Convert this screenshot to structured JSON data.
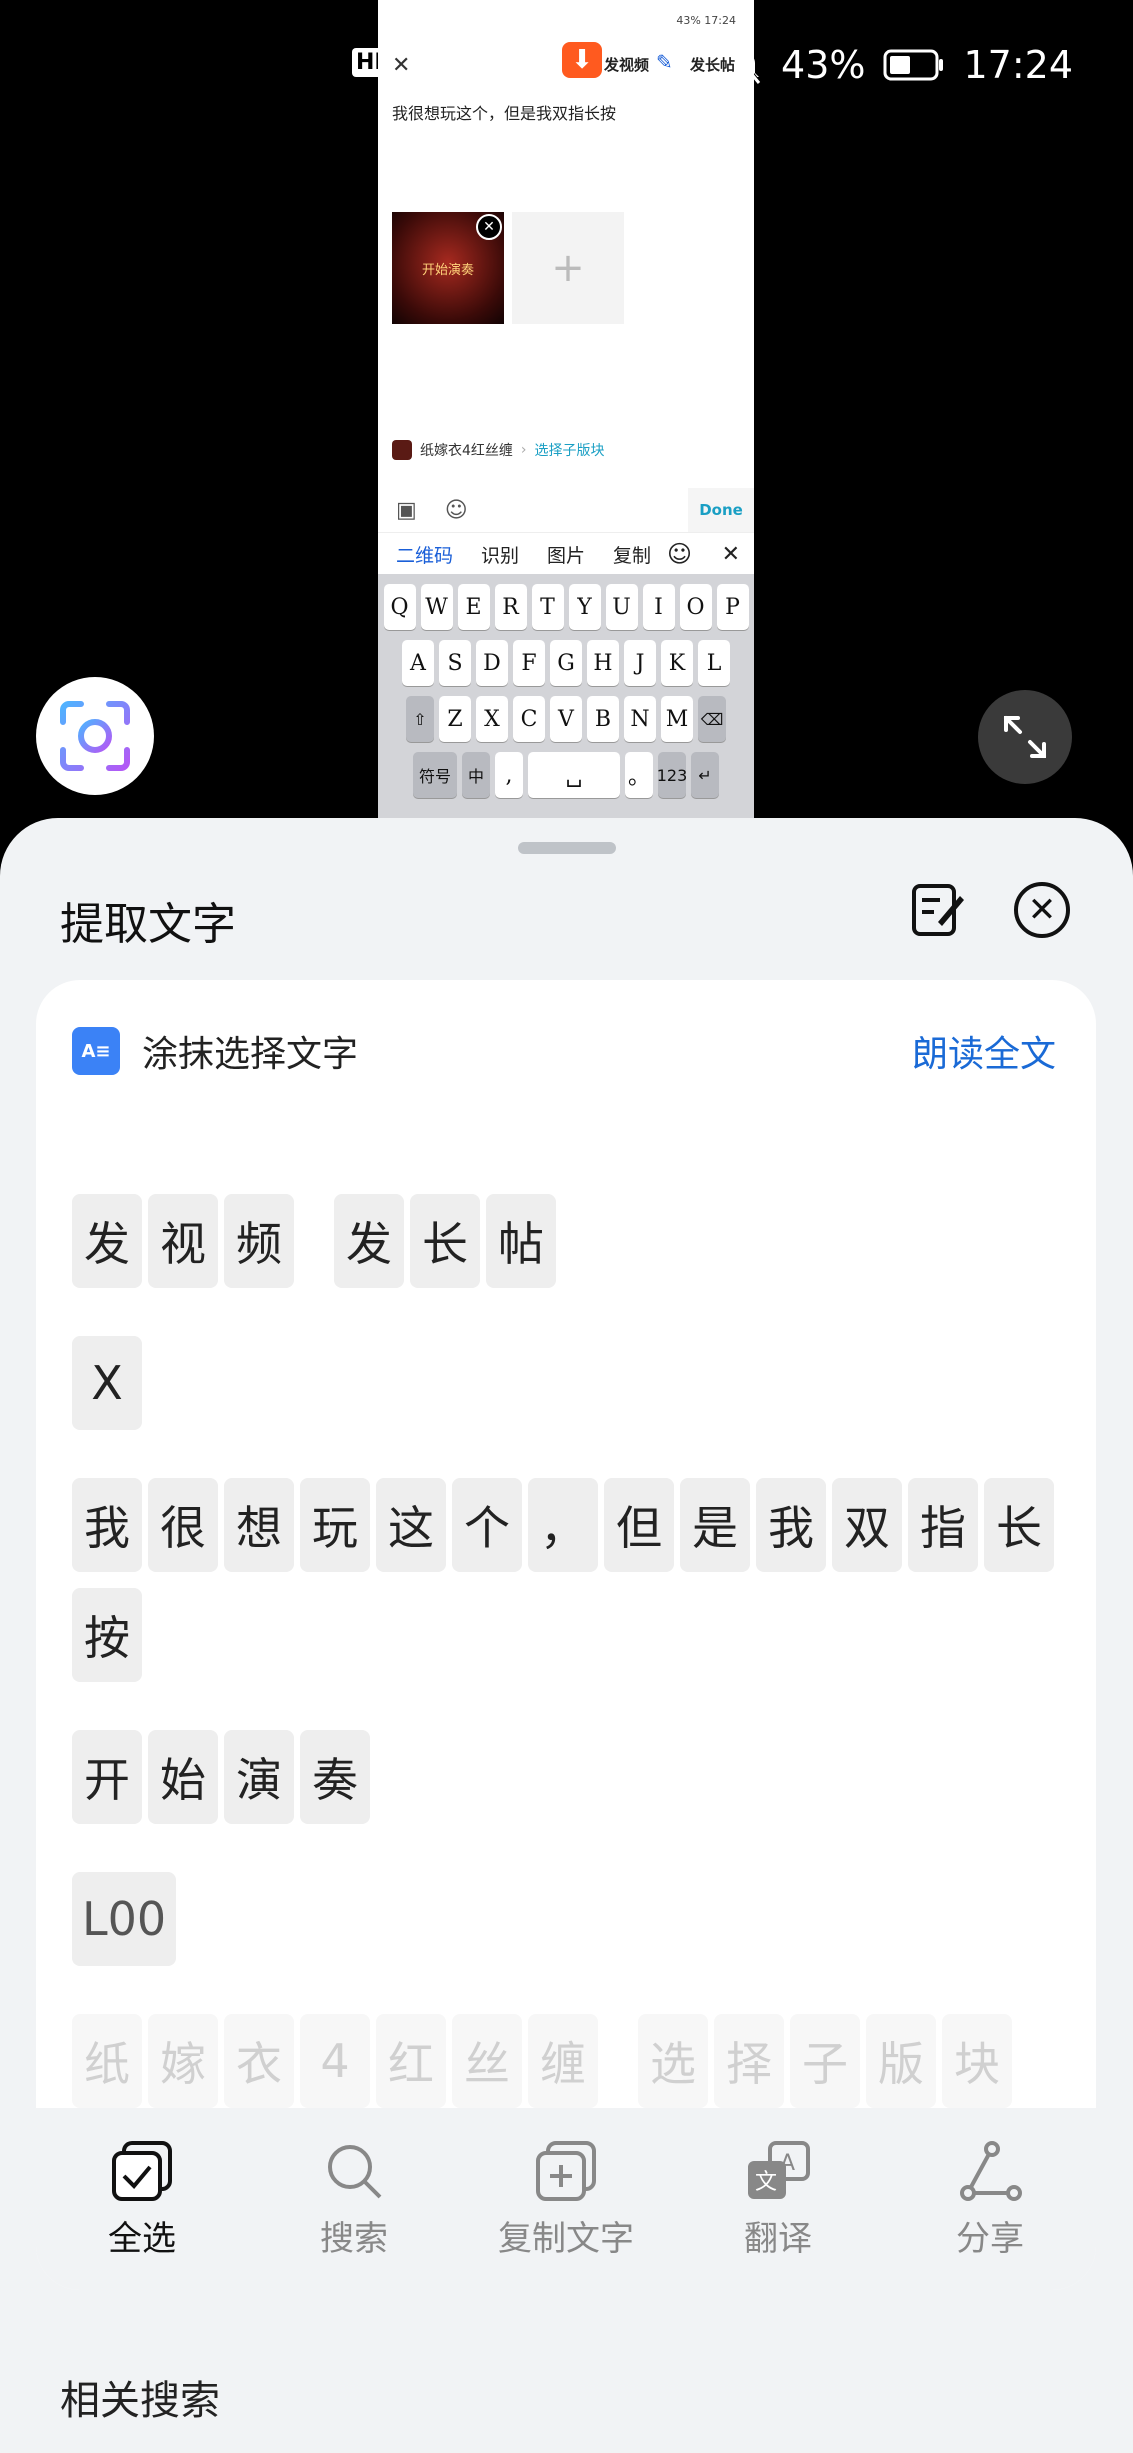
{
  "status_bar": {
    "hd": "HD",
    "battery": "43%",
    "time": "17:24"
  },
  "preview": {
    "mini_status": "43% 17:24",
    "send_video": "发视频",
    "send_long": "发长帖",
    "post_text": "我很想玩这个，但是我双指长按",
    "thumb_text": "开始演奏",
    "board_name": "纸嫁衣4红丝缠",
    "board_sub": "选择子版块",
    "done": "Done",
    "suggestions": [
      "二维码",
      "识别",
      "图片",
      "复制"
    ],
    "keyboard": {
      "row1": [
        "Q",
        "W",
        "E",
        "R",
        "T",
        "Y",
        "U",
        "I",
        "O",
        "P"
      ],
      "row2": [
        "A",
        "S",
        "D",
        "F",
        "G",
        "H",
        "J",
        "K",
        "L"
      ],
      "row3": [
        "Z",
        "X",
        "C",
        "V",
        "B",
        "N",
        "M"
      ],
      "symbols": "符号",
      "zh": "中",
      "comma": ",",
      "period": "。",
      "num": "123"
    }
  },
  "sheet": {
    "title": "提取文字",
    "smear_label": "涂抹选择文字",
    "read_all": "朗读全文",
    "lines": [
      [
        "发",
        "视",
        "频",
        "|",
        "发",
        "长",
        "帖"
      ],
      [
        "X"
      ],
      [
        "我",
        "很",
        "想",
        "玩",
        "这",
        "个",
        "，",
        "但",
        "是",
        "我",
        "双",
        "指",
        "长"
      ],
      [
        "按"
      ],
      [
        "开",
        "始",
        "演",
        "奏"
      ],
      [
        "L00"
      ],
      [
        "纸",
        "嫁",
        "衣",
        "4",
        "红",
        "丝",
        "缠",
        "|",
        "选",
        "择",
        "子",
        "版",
        "块"
      ]
    ],
    "tools": [
      "全选",
      "搜索",
      "复制文字",
      "翻译",
      "分享"
    ],
    "related": "相关搜索"
  }
}
